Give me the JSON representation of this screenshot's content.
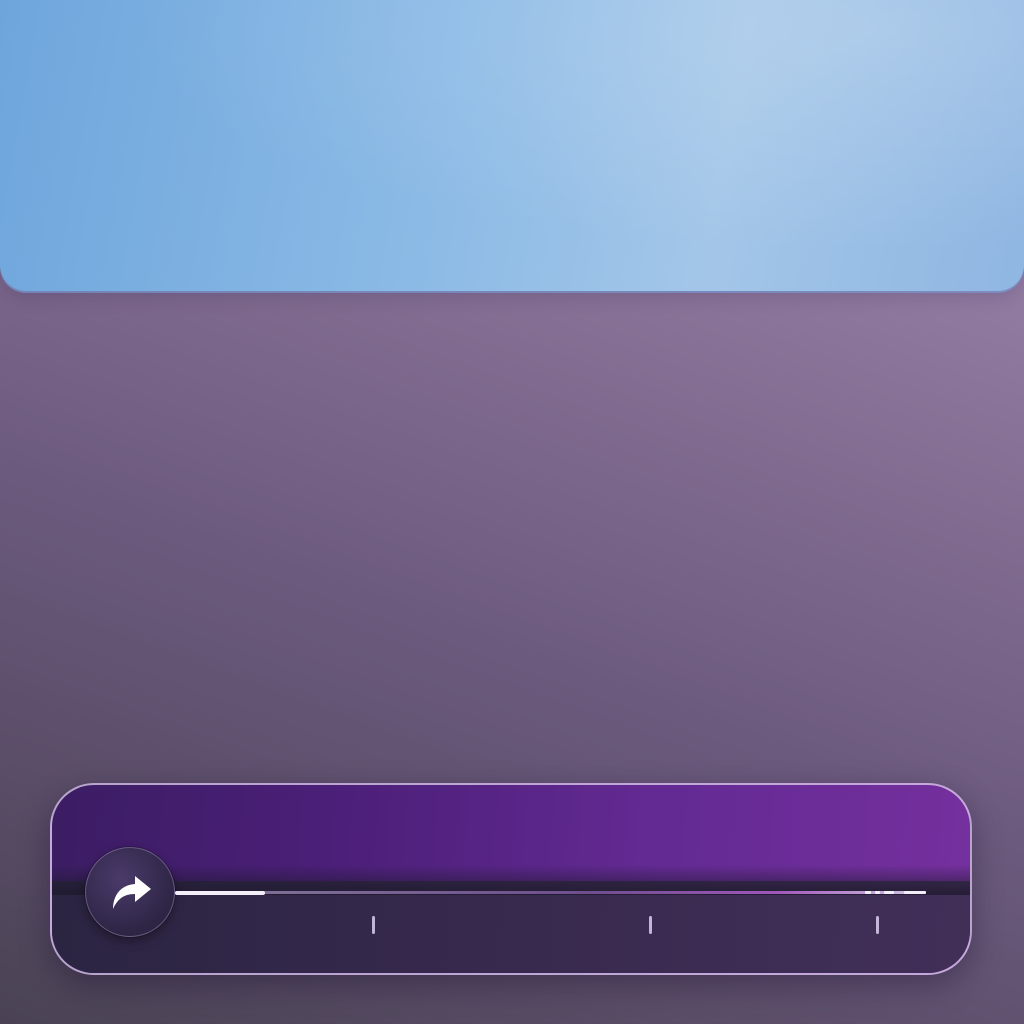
{
  "top_panel": {
    "accent": "#8dbbe6"
  },
  "player_bar": {
    "accent_left": "#3b1d63",
    "accent_right": "#75309e",
    "share_button": {
      "icon": "share-arrow-icon"
    },
    "progress": {
      "played_fraction": 0.12,
      "markers": 3
    }
  }
}
